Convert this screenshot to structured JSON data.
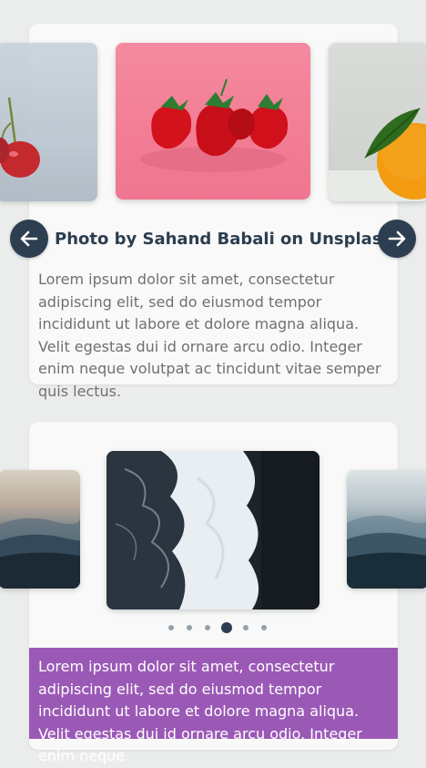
{
  "slider1": {
    "caption": "Photo by Sahand Babali on Unsplash",
    "text": "Lorem ipsum dolor sit amet, consectetur adipiscing elit, sed do eiusmod tempor incididunt ut labore et dolore magna aliqua. Velit egestas dui id ornare arcu odio. Integer enim neque volutpat ac tincidunt vitae semper quis lectus.",
    "prev_icon": "arrow-left-icon",
    "next_icon": "arrow-right-icon",
    "photos": [
      "cherry-photo",
      "strawberries-photo",
      "orange-photo"
    ]
  },
  "slider2": {
    "photos": [
      "mountains-photo",
      "ocean-waves-photo",
      "mountains-photo"
    ],
    "dots_total": 6,
    "active_dot": 4,
    "text": "Lorem ipsum dolor sit amet, consectetur adipiscing elit, sed do eiusmod tempor incididunt ut labore et dolore magna aliqua. Velit egestas dui id ornare arcu odio. Integer enim neque"
  },
  "colors": {
    "background": "#ebedec",
    "card": "#f8f9f8",
    "nav_button": "#2c3e50",
    "accent_purple": "#9b59b6"
  }
}
